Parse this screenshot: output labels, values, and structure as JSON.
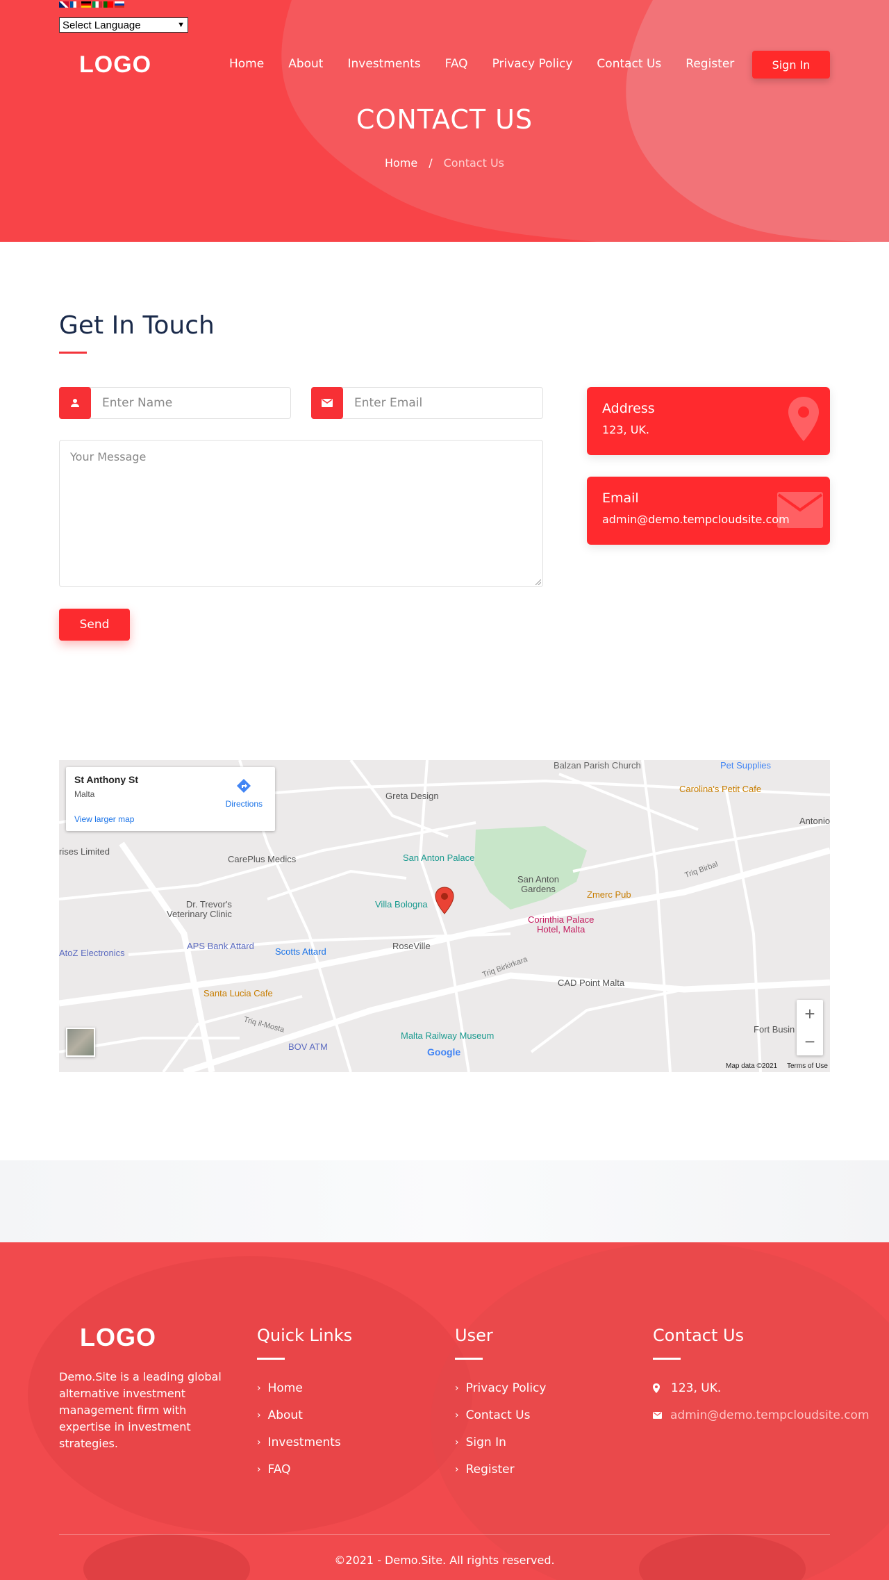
{
  "language": {
    "selected": "Select Language",
    "flags": [
      "en",
      "fr",
      "de",
      "it",
      "pt",
      "ru"
    ]
  },
  "header": {
    "logo": "LOGO",
    "nav": [
      "Home",
      "About",
      "Investments",
      "FAQ",
      "Privacy Policy",
      "Contact Us",
      "Register"
    ],
    "signin_label": "Sign In"
  },
  "hero": {
    "title": "CONTACT US",
    "breadcrumb_home": "Home",
    "breadcrumb_sep": "/",
    "breadcrumb_current": "Contact Us"
  },
  "contact": {
    "title": "Get In Touch",
    "name_placeholder": "Enter Name",
    "email_placeholder": "Enter Email",
    "message_placeholder": "Your Message",
    "send_label": "Send",
    "address_title": "Address",
    "address_value": "123, UK.",
    "email_title": "Email",
    "email_value": "admin@demo.tempcloudsite.com"
  },
  "map": {
    "place_name": "St Anthony St",
    "place_region": "Malta",
    "directions": "Directions",
    "larger_map": "View larger map",
    "attribution": "Map data ©2021",
    "terms": "Terms of Use",
    "google": "Google",
    "labels": [
      "Balzan Parish Church",
      "Pet Supplies",
      "Carolina's Petit Cafe",
      "Greta Design",
      "San Anton Palace",
      "San Anton Gardens",
      "Zmerc Pub",
      "CarePlus Medics",
      "Dr. Trevor's Veterinary Clinic",
      "Villa Bologna",
      "Corinthia Palace Hotel, Malta",
      "APS Bank Attard",
      "Scotts Attard",
      "RoseVille",
      "AtoZ Electronics",
      "CAD Point Malta",
      "Santa Lucia Cafe",
      "Malta Railway Museum",
      "BOV ATM",
      "Fort Busin",
      "Antonio",
      "rises Limited",
      "Triq Birkirkara",
      "Triq Birbal",
      "Triq il-Mosta"
    ]
  },
  "footer": {
    "logo": "LOGO",
    "description": "Demo.Site is a leading global alternative investment management firm with expertise in investment strategies.",
    "quick_links_title": "Quick Links",
    "quick_links": [
      "Home",
      "About",
      "Investments",
      "FAQ"
    ],
    "user_title": "User",
    "user_links": [
      "Privacy Policy",
      "Contact Us",
      "Sign In",
      "Register"
    ],
    "contact_title": "Contact Us",
    "contact_address": "123, UK.",
    "contact_email": "admin@demo.tempcloudsite.com",
    "copyright": "©2021 - Demo.Site. All rights reserved."
  },
  "colors": {
    "accent": "#f73035",
    "hero": "#f84448",
    "footer": "#f14a4d",
    "title": "#1a2a4a"
  }
}
